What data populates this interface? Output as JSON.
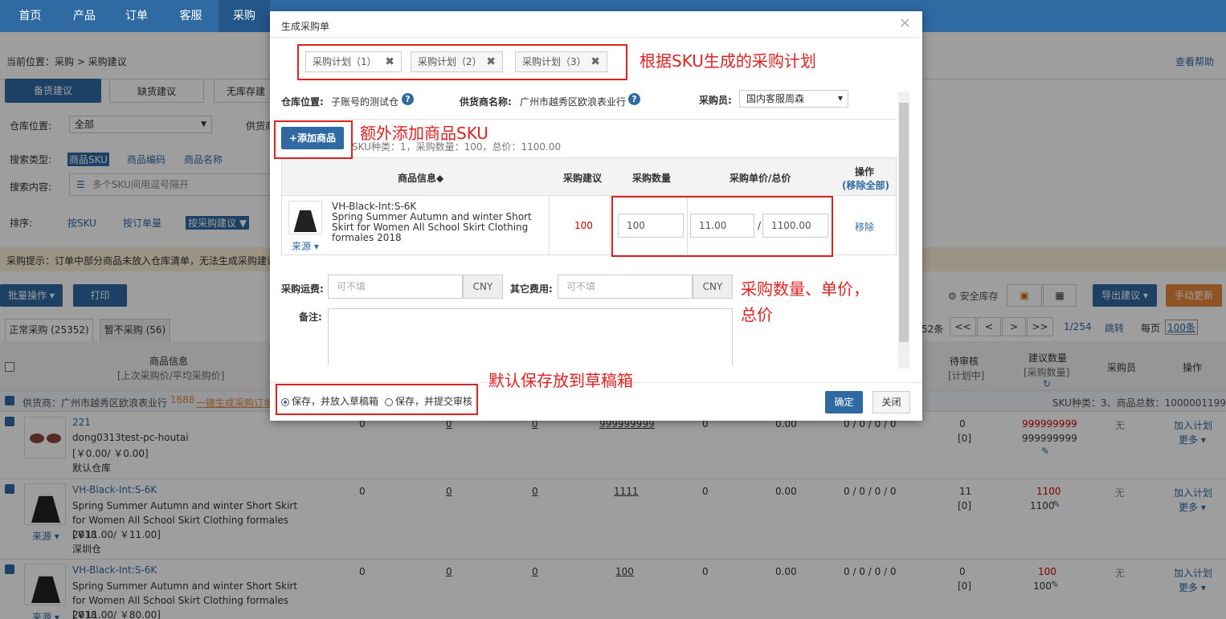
{
  "nav": [
    "首页",
    "产品",
    "订单",
    "客服",
    "采购"
  ],
  "breadcrumb": "当前位置：采购 > 采购建议",
  "help_link": "查看帮助",
  "suggest_tabs": [
    "备货建议",
    "缺货建议",
    "无库存建"
  ],
  "filter": {
    "warehouse_label": "仓库位置:",
    "warehouse_value": "全部",
    "supplier_label": "供货商",
    "search_type_label": "搜索类型:",
    "search_types": [
      "商品SKU",
      "商品编码",
      "商品名称"
    ],
    "search_content_label": "搜索内容:",
    "search_placeholder": "多个SKU间用逗号隔开",
    "sort_label": "排序:",
    "sorts": [
      "按SKU",
      "按订单量",
      "按采购建议 ▼"
    ]
  },
  "tip": "采购提示：订单中部分商品未放入仓库清单，无法生成采购建议",
  "actions": {
    "batch": "批量操作 ▾",
    "print": "打印",
    "safety_stock": "安全库存",
    "export": "导出建议 ▾",
    "manual_update": "手动更新"
  },
  "list_tabs": [
    "正常采购 (25352)",
    "暂不采购 (56)"
  ],
  "pagination": {
    "count": "52条",
    "first": "<<",
    "prev": "<",
    "next": ">",
    "last": ">>",
    "page": "1/254",
    "jump": "跳转",
    "per_page_label": "每页",
    "per_page": "100条"
  },
  "table_headers": {
    "product": "商品信息",
    "product_sub": "[上次采购价/平均采购价]",
    "pending": "待审核",
    "pending_sub": "[计划中]",
    "suggest": "建议数量",
    "suggest_sub": "[采购数量]",
    "buyer": "采购员",
    "op": "操作"
  },
  "supplier_row": {
    "text": "供货商：广州市越秀区欧浪表业行",
    "num": "1688",
    "link": "一键生成采购订单",
    "summary": "SKU种类：3、商品总数：1000001199"
  },
  "rows": [
    {
      "sku": "221",
      "name": "dong0313test-pc-houtai",
      "price": "[￥0.00/ ￥0.00]",
      "wh": "默认仓库",
      "source": "",
      "c1": "0",
      "c2": "0",
      "c3": "0",
      "c4": "999999999",
      "c5": "0",
      "c6": "0.00",
      "c7": "0 / 0 / 0 / 0",
      "pend": "0",
      "pend2": "[0]",
      "sug": "999999999",
      "sug2": "999999999",
      "buyer": "无",
      "op1": "加入计划",
      "op2": "更多 ▾"
    },
    {
      "sku": "VH-Black-Int:S-6K",
      "name": "Spring Summer Autumn and winter Short Skirt for Women All School Skirt Clothing formales 2018",
      "price": "[￥11.00/ ￥11.00]",
      "wh": "深圳仓",
      "source": "来源 ▾",
      "c1": "0",
      "c2": "0",
      "c3": "0",
      "c4": "1111",
      "c5": "0",
      "c6": "0.00",
      "c7": "0 / 0 / 0 / 0",
      "pend": "11",
      "pend2": "[0]",
      "sug": "1100",
      "sug2": "1100",
      "buyer": "无",
      "op1": "加入计划",
      "op2": "更多 ▾"
    },
    {
      "sku": "VH-Black-Int:S-6K",
      "name": "Spring Summer Autumn and winter Short Skirt for Women All School Skirt Clothing formales 2018",
      "price": "[￥11.00/ ￥80.00]",
      "wh": "",
      "source": "来源 ▾",
      "c1": "0",
      "c2": "0",
      "c3": "0",
      "c4": "100",
      "c5": "0",
      "c6": "0.00",
      "c7": "0 / 0 / 0 / 0",
      "pend": "0",
      "pend2": "[0]",
      "sug": "100",
      "sug2": "100",
      "buyer": "无",
      "op1": "加入计划",
      "op2": "更多 ▾"
    }
  ],
  "modal": {
    "title": "生成采购单",
    "close": "×",
    "plan_tabs": [
      "采购计划（1）",
      "采购计划（2）",
      "采购计划（3）"
    ],
    "warehouse_label": "仓库位置:",
    "warehouse_value": "子账号的测试仓",
    "supplier_label": "供货商名称:",
    "supplier_value": "广州市越秀区欧浪表业行",
    "buyer_label": "采购员:",
    "buyer_value": "国内客服周森",
    "add_btn": "+添加商品",
    "summary": "SKU种类：1，采购数量：100，总价：1100.00",
    "headers": {
      "info": "商品信息◆",
      "suggest": "采购建议",
      "qty": "采购数量",
      "price": "采购单价/总价",
      "op": "操作",
      "remove_all": "(移除全部)"
    },
    "item": {
      "sku": "VH-Black-Int:S-6K",
      "name": "Spring Summer Autumn and winter Short Skirt for Women All School Skirt Clothing formales 2018",
      "source": "来源 ▾",
      "suggest": "100",
      "qty": "100",
      "unit": "11.00",
      "sep": "/",
      "total": "1100.00",
      "remove": "移除"
    },
    "freight_label": "采购运费:",
    "freight_placeholder": "可不填",
    "currency": "CNY",
    "other_label": "其它费用:",
    "other_placeholder": "可不填",
    "remark_label": "备注:",
    "radio1": "保存，并放入草稿箱",
    "radio2": "保存，并提交审核",
    "ok": "确定",
    "cancel": "关闭"
  },
  "annotations": {
    "a1": "根据SKU生成的采购计划",
    "a2": "额外添加商品SKU",
    "a3": "采购数量、单价，",
    "a3b": "总价",
    "a4": "默认保存放到草稿箱"
  },
  "colors": {
    "primary": "#2f6aa3",
    "annotation": "#d22"
  }
}
